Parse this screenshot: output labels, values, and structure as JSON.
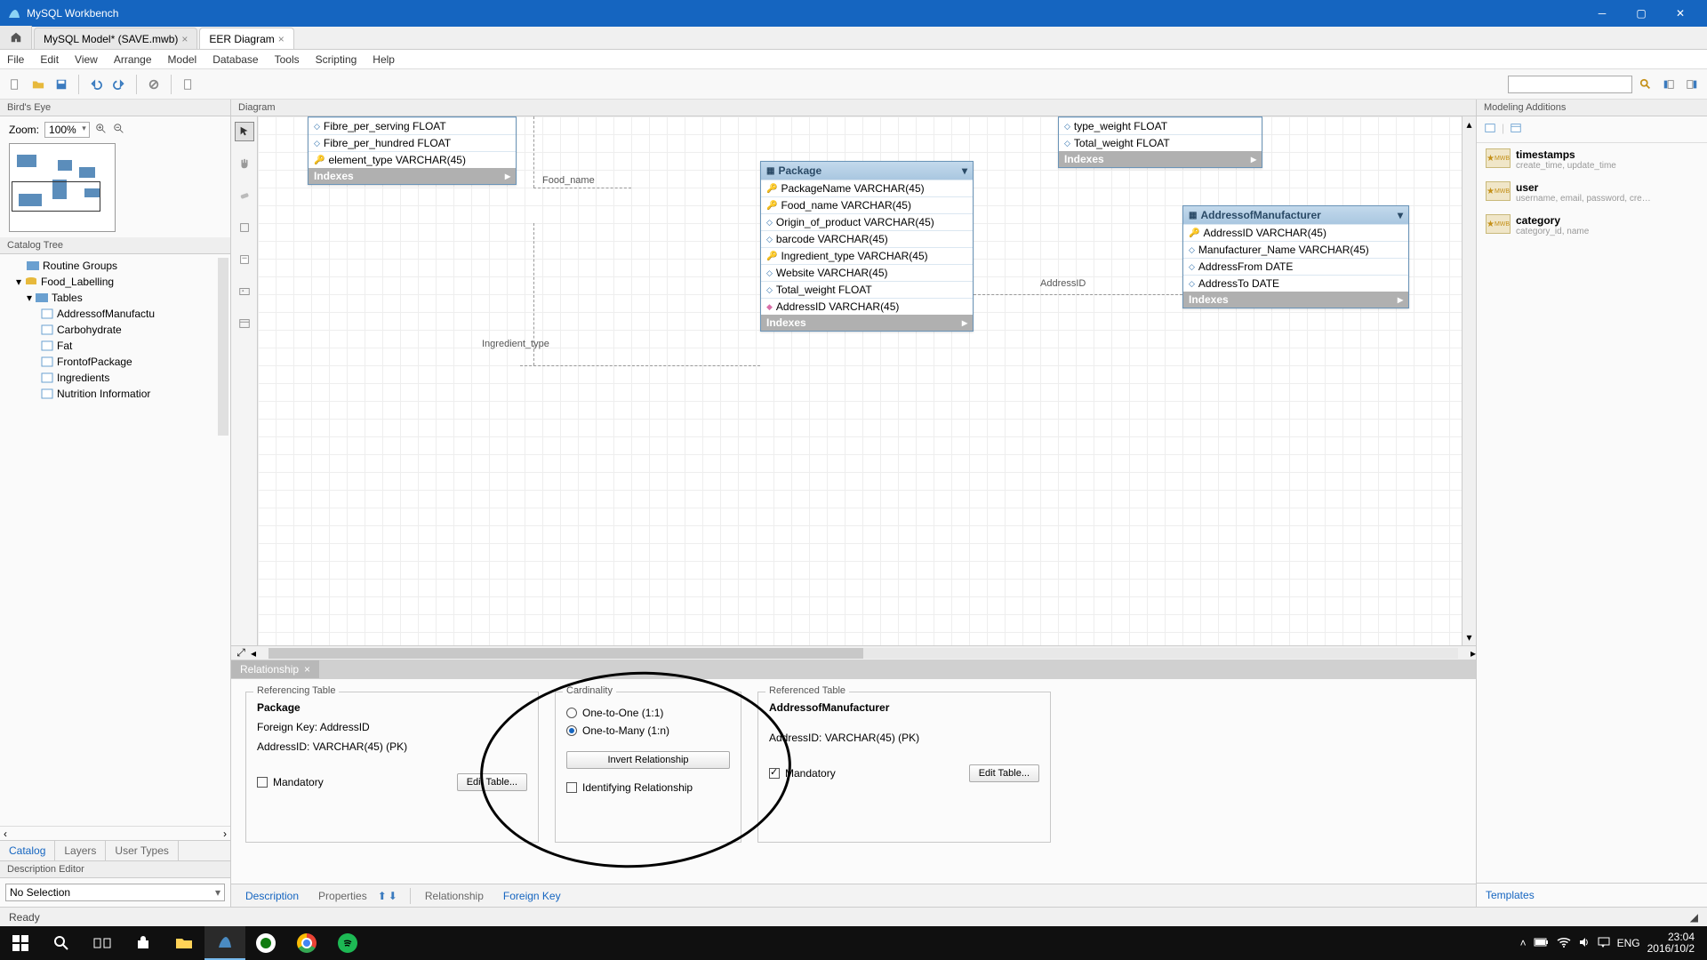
{
  "titlebar": {
    "app": "MySQL Workbench"
  },
  "tabs": {
    "model": "MySQL Model* (SAVE.mwb)",
    "eer": "EER Diagram"
  },
  "menu": [
    "File",
    "Edit",
    "View",
    "Arrange",
    "Model",
    "Database",
    "Tools",
    "Scripting",
    "Help"
  ],
  "birds_eye": {
    "title": "Bird's Eye",
    "zoom_label": "Zoom:",
    "zoom_value": "100%"
  },
  "catalog": {
    "title": "Catalog Tree",
    "items": {
      "routine": "Routine Groups",
      "schema": "Food_Labelling",
      "tables": "Tables",
      "t0": "AddressofManufactu",
      "t1": "Carbohydrate",
      "t2": "Fat",
      "t3": "FrontofPackage",
      "t4": "Ingredients",
      "t5": "Nutrition Informatior"
    },
    "bottom_tabs": {
      "catalog": "Catalog",
      "layers": "Layers",
      "usertypes": "User Types"
    }
  },
  "desc_editor": {
    "title": "Description Editor",
    "value": "No Selection"
  },
  "diagram": {
    "title": "Diagram",
    "labels": {
      "food_name": "Food_name",
      "ingredient_type": "Ingredient_type",
      "address_id": "AddressID"
    },
    "entity_partial": {
      "rows": [
        "Fibre_per_serving FLOAT",
        "Fibre_per_hundred FLOAT",
        "element_type VARCHAR(45)"
      ],
      "indexes": "Indexes"
    },
    "entity_right_partial": {
      "rows": [
        "type_weight FLOAT",
        "Total_weight FLOAT"
      ],
      "indexes": "Indexes"
    },
    "package": {
      "name": "Package",
      "rows": [
        "PackageName VARCHAR(45)",
        "Food_name VARCHAR(45)",
        "Origin_of_product VARCHAR(45)",
        "barcode VARCHAR(45)",
        "Ingredient_type VARCHAR(45)",
        "Website VARCHAR(45)",
        "Total_weight FLOAT",
        "AddressID VARCHAR(45)"
      ],
      "indexes": "Indexes"
    },
    "address": {
      "name": "AddressofManufacturer",
      "rows": [
        "AddressID VARCHAR(45)",
        "Manufacturer_Name VARCHAR(45)",
        "AddressFrom DATE",
        "AddressTo DATE"
      ],
      "indexes": "Indexes"
    }
  },
  "rel_tab": {
    "label": "Relationship"
  },
  "rel_panel": {
    "ref_table": {
      "legend": "Referencing Table",
      "name": "Package",
      "fk": "Foreign Key: AddressID",
      "col": "AddressID: VARCHAR(45) (PK)",
      "mandatory": "Mandatory",
      "edit": "Edit Table..."
    },
    "cardinality": {
      "legend": "Cardinality",
      "one_one": "One-to-One (1:1)",
      "one_many": "One-to-Many (1:n)",
      "invert": "Invert Relationship",
      "identifying": "Identifying Relationship"
    },
    "refd_table": {
      "legend": "Referenced Table",
      "name": "AddressofManufacturer",
      "col": "AddressID: VARCHAR(45) (PK)",
      "mandatory": "Mandatory",
      "edit": "Edit Table..."
    }
  },
  "center_bottom": {
    "description": "Description",
    "properties": "Properties",
    "relationship": "Relationship",
    "foreign_key": "Foreign Key"
  },
  "right": {
    "title": "Modeling Additions",
    "items": [
      {
        "name": "timestamps",
        "desc": "create_time, update_time"
      },
      {
        "name": "user",
        "desc": "username, email, password, cre…"
      },
      {
        "name": "category",
        "desc": "category_id, name"
      }
    ],
    "templates": "Templates"
  },
  "status": {
    "text": "Ready"
  },
  "taskbar": {
    "lang": "ENG",
    "time": "23:04",
    "date": "2016/10/2"
  }
}
